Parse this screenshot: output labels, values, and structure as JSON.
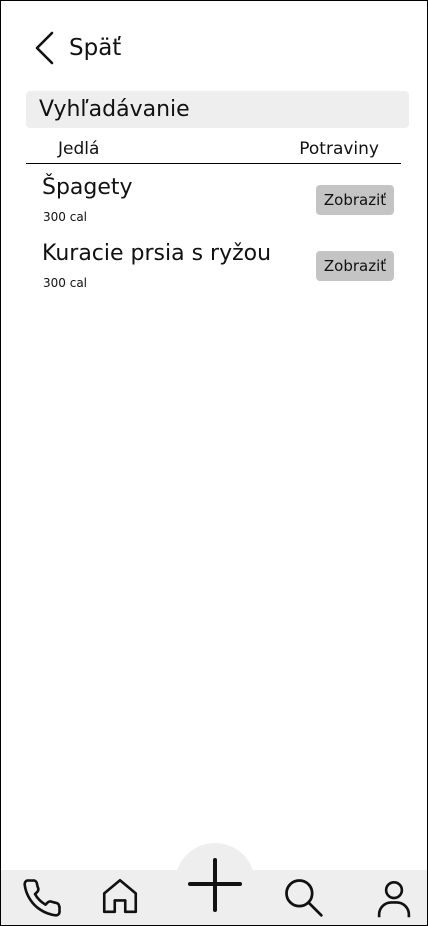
{
  "header": {
    "back_label": "Späť"
  },
  "search": {
    "label": "Vyhľadávanie"
  },
  "tabs": [
    {
      "label": "Jedlá"
    },
    {
      "label": "Potraviny"
    }
  ],
  "items": [
    {
      "name": "Špagety",
      "calories": "300 cal",
      "button_label": "Zobraziť"
    },
    {
      "name": "Kuracie prsia s ryžou",
      "calories": "300 cal",
      "button_label": "Zobraziť"
    }
  ],
  "nav": {
    "icons": [
      "phone-icon",
      "home-icon",
      "plus-icon",
      "search-icon",
      "user-icon"
    ]
  },
  "colors": {
    "surface": "#eeeeee",
    "button": "#c4c4c4",
    "text": "#111111"
  }
}
